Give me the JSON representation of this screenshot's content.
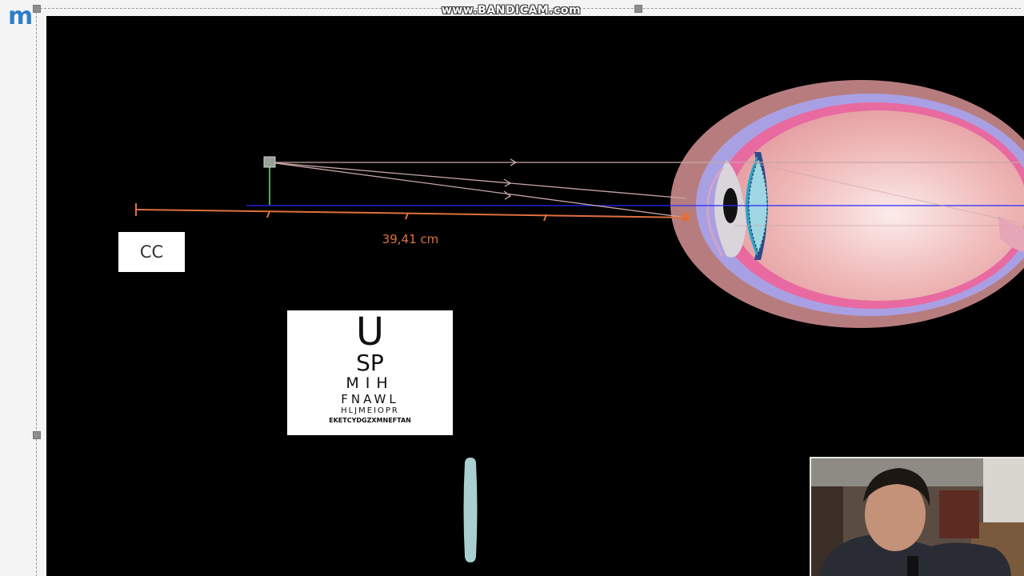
{
  "app": {
    "logo_text": "m",
    "brand_color": "#2f7fc7"
  },
  "watermark": {
    "text": "www.BANDICAM.com"
  },
  "simulation": {
    "background": "#000000",
    "distance_label": "39,41 cm",
    "near_point_label": "CC",
    "ray_color": "#c8a6a6",
    "ruler_color": "#e0703a",
    "optical_axis_color": "#2b2bff",
    "object_color": "#4caf50"
  },
  "eye_chart": {
    "rows": [
      "U",
      "SP",
      "MIH",
      "FNAWL",
      "HLJMEIOPR",
      "EKETCYDGZXMNEFTAN"
    ]
  },
  "lens": {
    "icon": "diverging-lens-icon",
    "color": "#a9cfcf"
  },
  "webcam": {
    "icon": "presenter-video-icon"
  }
}
